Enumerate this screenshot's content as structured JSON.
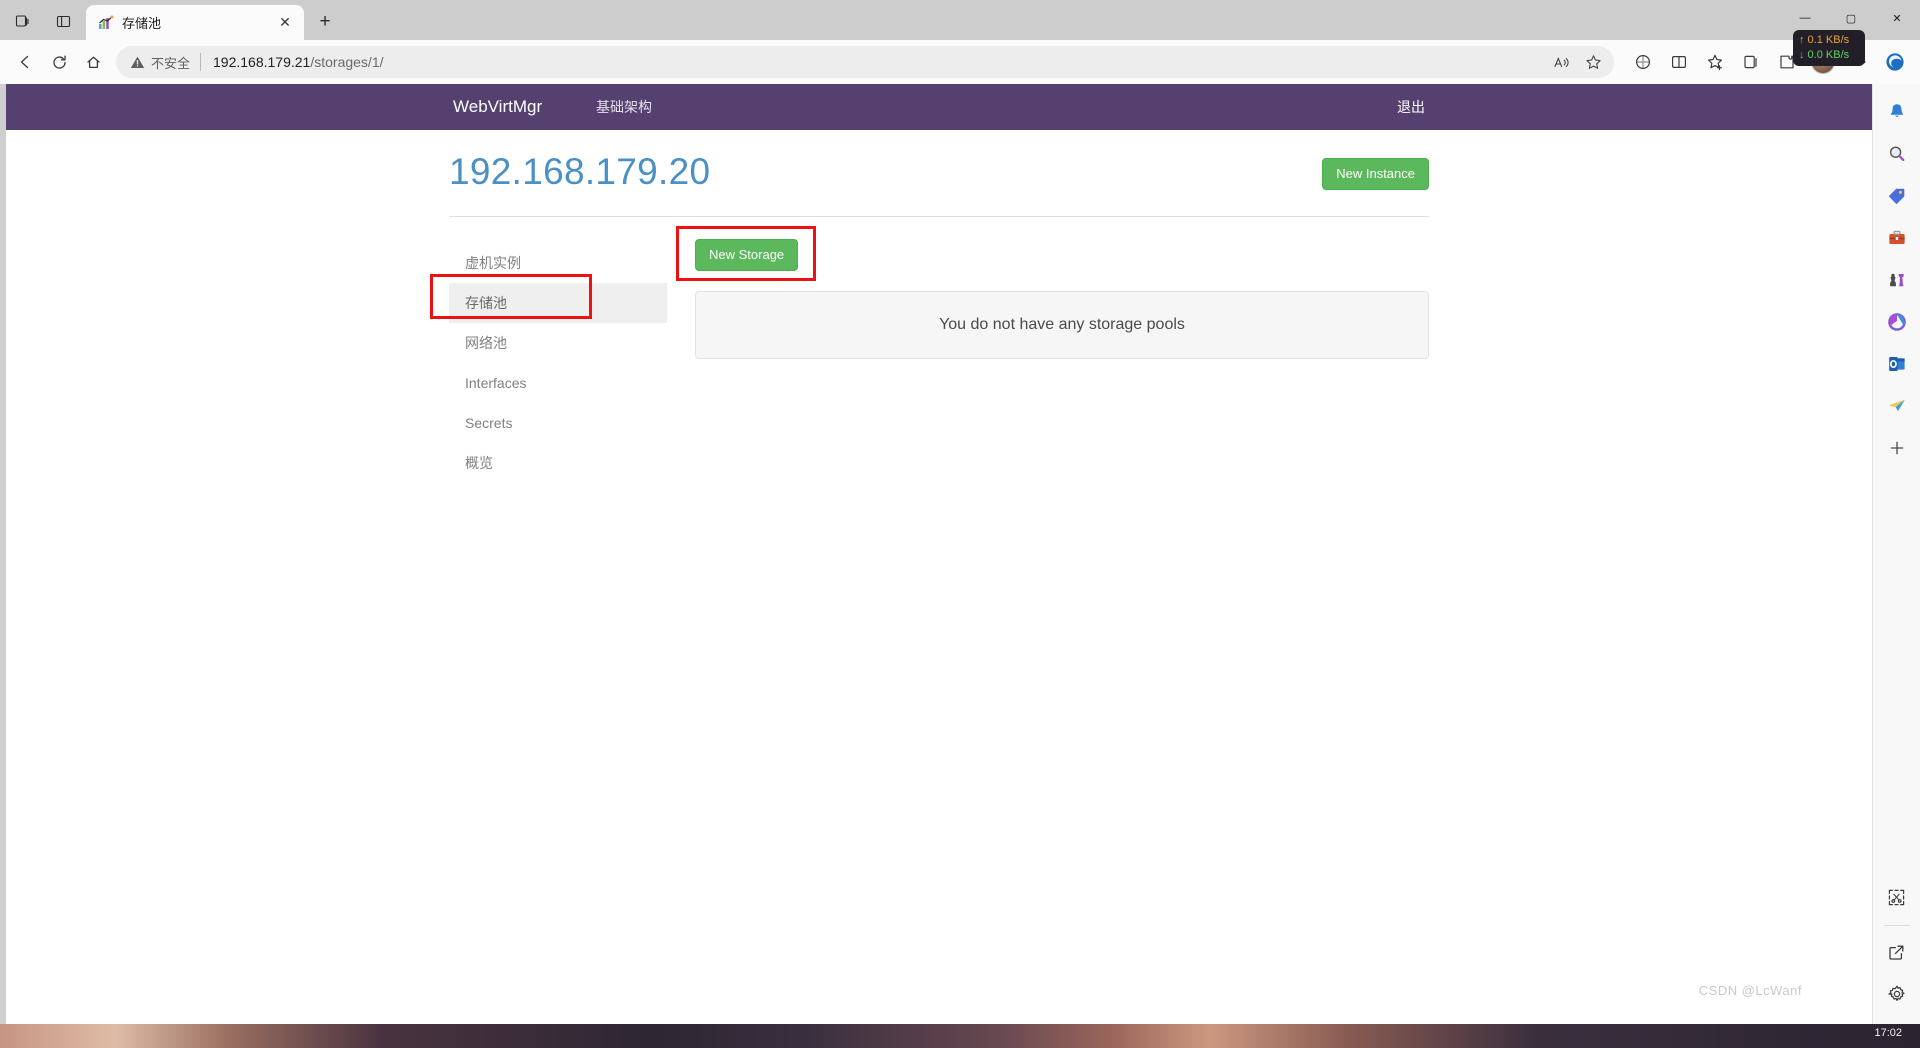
{
  "browser": {
    "tab": {
      "title": "存储池",
      "favicon": "chart-favicon",
      "close_label": "✕"
    },
    "new_tab_label": "+",
    "window_controls": {
      "minimize": "—",
      "maximize": "▢",
      "close": "✕"
    },
    "toolbar_left": [
      "task-view-icon",
      "split-screen-icon"
    ],
    "nav": {
      "back": "←",
      "refresh": "⟳",
      "home": "⌂"
    },
    "omnibox": {
      "security_label": "不安全",
      "url_host": "192.168.179.21",
      "url_path": "/storages/1/",
      "read_aloud": "read-aloud-icon",
      "favorite": "star-icon"
    },
    "toolbar_right": [
      "browser-essentials-icon",
      "split-screen-icon",
      "favorites-icon",
      "collections-icon",
      "extensions-icon",
      "profile-avatar",
      "settings-more-icon",
      "copilot-icon"
    ]
  },
  "netspeed": {
    "upload": "↑ 0.1 KB/s",
    "download": "↓ 0.0 KB/s",
    "upload_color": "#e8a33d",
    "download_color": "#5fd35f"
  },
  "app": {
    "brand": "WebVirtMgr",
    "nav_link": "基础架构",
    "logout": "退出",
    "navbar_color": "#55406f"
  },
  "page": {
    "title": "192.168.179.20",
    "title_color": "#4a90c4",
    "new_instance_label": "New Instance",
    "new_storage_label": "New Storage",
    "button_color": "#5cb85c",
    "empty_message": "You do not have any storage pools"
  },
  "sidebar": {
    "items": [
      {
        "label": "虚机实例",
        "active": false
      },
      {
        "label": "存储池",
        "active": true
      },
      {
        "label": "网络池",
        "active": false
      },
      {
        "label": "Interfaces",
        "active": false
      },
      {
        "label": "Secrets",
        "active": false
      },
      {
        "label": "概览",
        "active": false
      }
    ]
  },
  "edge_sidebar": {
    "items": [
      "notifications-bell-icon",
      "search-icon",
      "shopping-tag-icon",
      "tools-briefcase-icon",
      "games-chess-icon",
      "microsoft365-icon",
      "outlook-icon",
      "travel-plane-icon",
      "add-sidebar-icon"
    ],
    "bottom_items": [
      "screenshot-snip-icon",
      "open-in-new-icon",
      "settings-gear-icon"
    ]
  },
  "watermark": {
    "text": "CSDN @LcWanf"
  },
  "taskbar": {
    "clock": "17:02"
  }
}
